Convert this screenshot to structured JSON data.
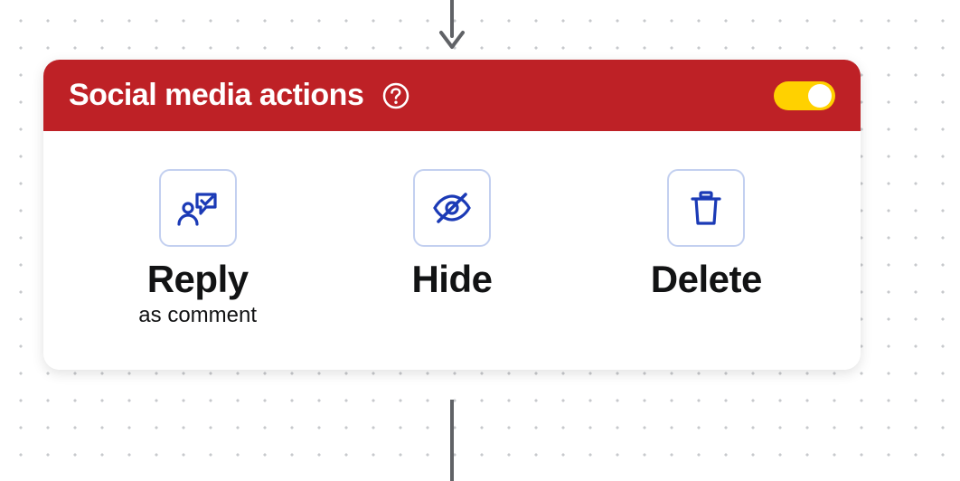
{
  "colors": {
    "header_bg": "#BE2126",
    "header_text": "#FFFFFF",
    "toggle_bg": "#FFD100",
    "icon_stroke": "#1B3AB6",
    "connector": "#606266"
  },
  "header": {
    "title": "Social media actions",
    "toggle_on": true
  },
  "actions": [
    {
      "key": "reply",
      "title": "Reply",
      "subtitle": "as comment",
      "icon": "reply-user-icon"
    },
    {
      "key": "hide",
      "title": "Hide",
      "subtitle": "",
      "icon": "eye-off-icon"
    },
    {
      "key": "delete",
      "title": "Delete",
      "subtitle": "",
      "icon": "trash-icon"
    }
  ]
}
